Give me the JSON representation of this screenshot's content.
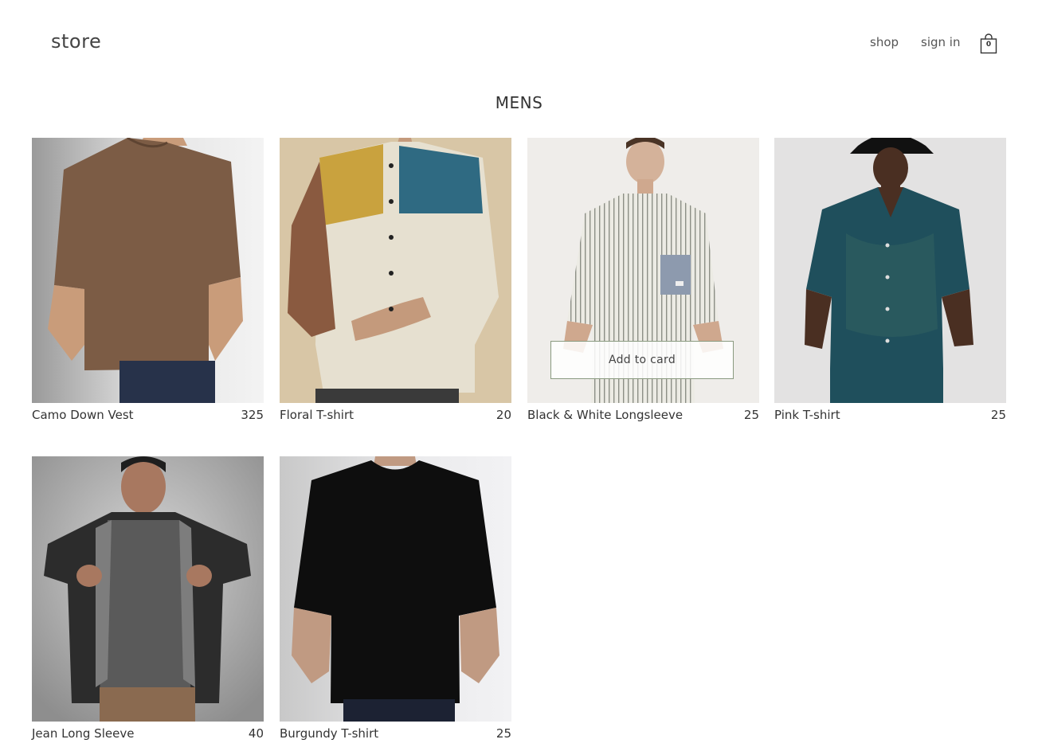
{
  "header": {
    "logo": "store",
    "nav": {
      "shop": "shop",
      "sign_in": "sign in"
    },
    "cart_count": "0"
  },
  "page_title": "MENS",
  "products": [
    {
      "name": "Camo Down Vest",
      "price": "325"
    },
    {
      "name": "Floral T-shirt",
      "price": "20"
    },
    {
      "name": "Black & White Longsleeve",
      "price": "25",
      "button": "Add to card"
    },
    {
      "name": "Pink T-shirt",
      "price": "25"
    },
    {
      "name": "Jean Long Sleeve",
      "price": "40"
    },
    {
      "name": "Burgundy T-shirt",
      "price": "25"
    }
  ],
  "icons": {
    "cart": "shopping-bag-icon"
  },
  "colors": {
    "text": "#333333",
    "button_border": "#8a9a80"
  }
}
